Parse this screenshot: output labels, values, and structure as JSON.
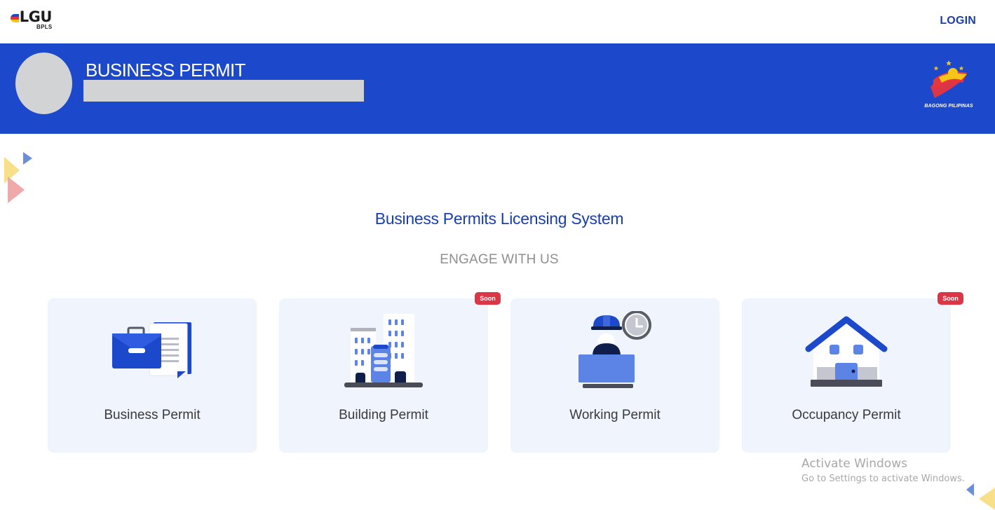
{
  "nav": {
    "logo_text": "LGU",
    "logo_sub": "BPLS",
    "login_label": "LOGIN"
  },
  "banner": {
    "title": "BUSINESS PERMIT",
    "emblem_text": "BAGONG PILIPINAS",
    "background_color": "#1c48cc"
  },
  "main": {
    "title": "Business Permits Licensing System",
    "subtitle": "ENGAGE WITH US"
  },
  "cards": [
    {
      "label": "Business Permit",
      "icon": "briefcase-document-icon",
      "badge": ""
    },
    {
      "label": "Building Permit",
      "icon": "buildings-icon",
      "badge": "Soon"
    },
    {
      "label": "Working Permit",
      "icon": "worker-clock-icon",
      "badge": ""
    },
    {
      "label": "Occupancy Permit",
      "icon": "house-icon",
      "badge": "Soon"
    }
  ],
  "watermark": {
    "line1": "Activate Windows",
    "line2": "Go to Settings to activate Windows."
  },
  "colors": {
    "accent": "#1b3fa8",
    "card_bg": "#eff4fd",
    "badge": "#dc3545"
  }
}
